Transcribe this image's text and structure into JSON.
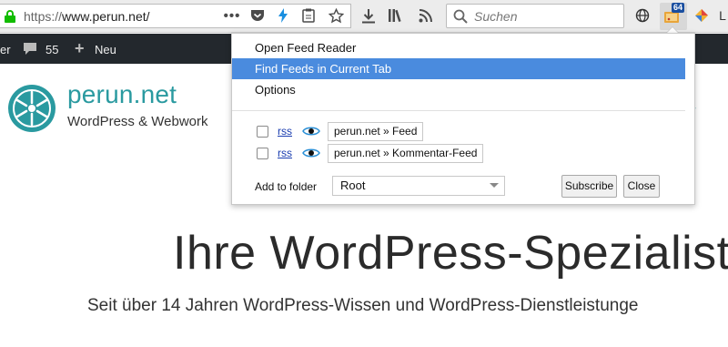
{
  "browser": {
    "url_protocol": "https://",
    "url_host": "www.perun.net/",
    "search_placeholder": "Suchen",
    "extension_badge": "64",
    "overflow_text": "L"
  },
  "adminbar": {
    "left_fragment": "er",
    "comments_count": "55",
    "new_label": "Neu"
  },
  "site": {
    "title": "perun.net",
    "tagline": "WordPress & Webwork",
    "hero_title": "Ihre WordPress-Spezialist",
    "hero_subtitle": "Seit über 14 Jahren WordPress-Wissen und WordPress-Dienstleistunge",
    "brand_color": "#2a9aa0"
  },
  "popup": {
    "menu": [
      {
        "label": "Open Feed Reader",
        "selected": false
      },
      {
        "label": "Find Feeds in Current Tab",
        "selected": true
      },
      {
        "label": "Options",
        "selected": false
      }
    ],
    "feeds": [
      {
        "type": "rss",
        "name": "perun.net » Feed",
        "checked": false
      },
      {
        "type": "rss",
        "name": "perun.net » Kommentar-Feed",
        "checked": false
      }
    ],
    "folder_label": "Add to folder",
    "folder_value": "Root",
    "subscribe_label": "Subscribe",
    "close_label": "Close",
    "highlight_color": "#4a8bde"
  }
}
